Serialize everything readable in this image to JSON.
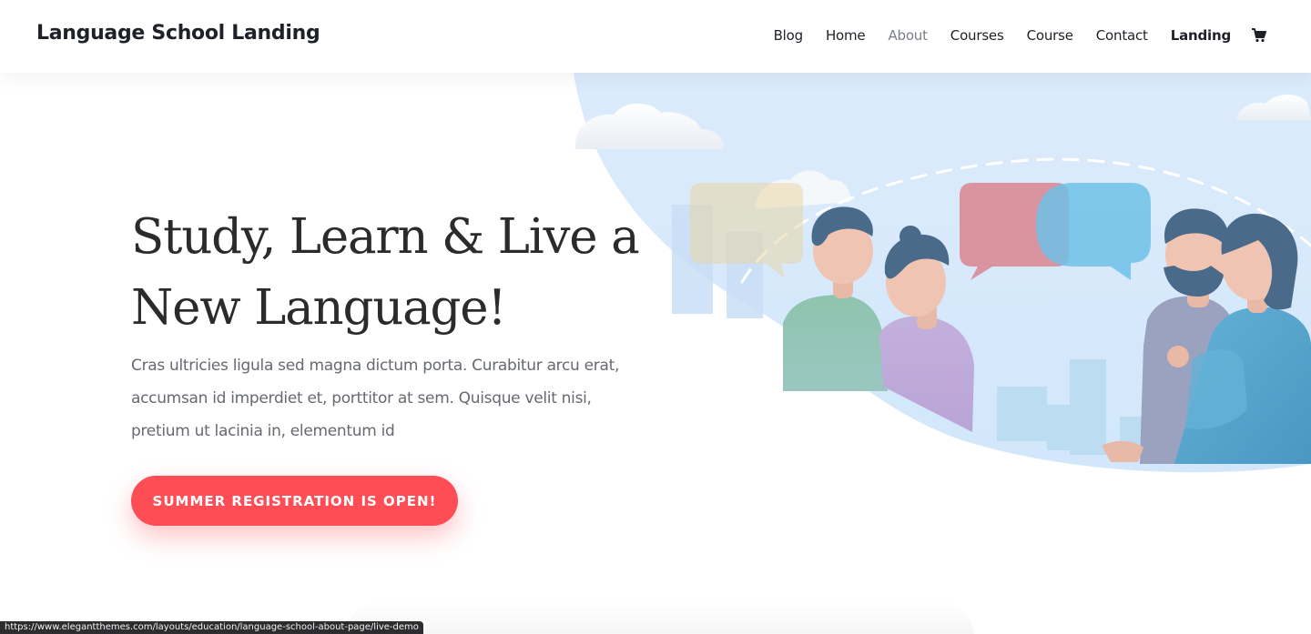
{
  "header": {
    "logo": "Language School Landing",
    "nav": [
      {
        "label": "Blog"
      },
      {
        "label": "Home"
      },
      {
        "label": "About"
      },
      {
        "label": "Courses"
      },
      {
        "label": "Course"
      },
      {
        "label": "Contact"
      },
      {
        "label": "Landing"
      }
    ],
    "cart_icon": "shopping-cart-icon"
  },
  "hero": {
    "title": "Study, Learn & Live a New Language!",
    "description": "Cras ultricies ligula sed magna dictum porta. Curabitur arcu erat, accumsan id imperdiet et, porttitor at sem. Quisque velit nisi, pretium ut lacinia in, elementum id",
    "cta_label": "SUMMER REGISTRATION IS OPEN!",
    "illustration": "people-chatting-illustration"
  },
  "status_bar": {
    "url": "https://www.elegantthemes.com/layouts/education/language-school-about-page/live-demo"
  },
  "colors": {
    "accent": "#ff4d55",
    "text_dark": "#2b2b2b",
    "text_body": "#666a70",
    "nav_active": "#7a7f87",
    "sky": "#d9ecfb"
  }
}
